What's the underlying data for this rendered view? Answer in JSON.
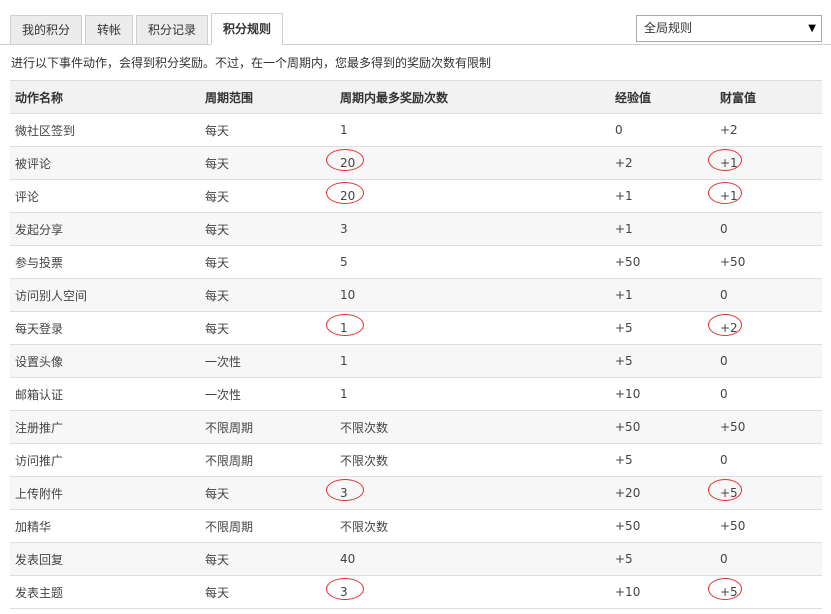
{
  "tabs": [
    {
      "label": "我的积分",
      "active": false
    },
    {
      "label": "转帐",
      "active": false
    },
    {
      "label": "积分记录",
      "active": false
    },
    {
      "label": "积分规则",
      "active": true
    }
  ],
  "rule_select": {
    "selected": "全局规则"
  },
  "intro": "进行以下事件动作，会得到积分奖励。不过，在一个周期内，您最多得到的奖励次数有限制",
  "columns": [
    "动作名称",
    "周期范围",
    "周期内最多奖励次数",
    "经验值",
    "财富值"
  ],
  "rows": [
    {
      "action": "微社区签到",
      "period": "每天",
      "max": "1",
      "exp": "0",
      "wealth": "+2",
      "circle_max": false,
      "circle_wealth": false
    },
    {
      "action": "被评论",
      "period": "每天",
      "max": "20",
      "exp": "+2",
      "wealth": "+1",
      "circle_max": true,
      "circle_wealth": true
    },
    {
      "action": "评论",
      "period": "每天",
      "max": "20",
      "exp": "+1",
      "wealth": "+1",
      "circle_max": true,
      "circle_wealth": true
    },
    {
      "action": "发起分享",
      "period": "每天",
      "max": "3",
      "exp": "+1",
      "wealth": "0",
      "circle_max": false,
      "circle_wealth": false
    },
    {
      "action": "参与投票",
      "period": "每天",
      "max": "5",
      "exp": "+50",
      "wealth": "+50",
      "circle_max": false,
      "circle_wealth": false
    },
    {
      "action": "访问别人空间",
      "period": "每天",
      "max": "10",
      "exp": "+1",
      "wealth": "0",
      "circle_max": false,
      "circle_wealth": false
    },
    {
      "action": "每天登录",
      "period": "每天",
      "max": "1",
      "exp": "+5",
      "wealth": "+2",
      "circle_max": true,
      "circle_wealth": true
    },
    {
      "action": "设置头像",
      "period": "一次性",
      "max": "1",
      "exp": "+5",
      "wealth": "0",
      "circle_max": false,
      "circle_wealth": false
    },
    {
      "action": "邮箱认证",
      "period": "一次性",
      "max": "1",
      "exp": "+10",
      "wealth": "0",
      "circle_max": false,
      "circle_wealth": false
    },
    {
      "action": "注册推广",
      "period": "不限周期",
      "max": "不限次数",
      "exp": "+50",
      "wealth": "+50",
      "circle_max": false,
      "circle_wealth": false
    },
    {
      "action": "访问推广",
      "period": "不限周期",
      "max": "不限次数",
      "exp": "+5",
      "wealth": "0",
      "circle_max": false,
      "circle_wealth": false
    },
    {
      "action": "上传附件",
      "period": "每天",
      "max": "3",
      "exp": "+20",
      "wealth": "+5",
      "circle_max": true,
      "circle_wealth": true
    },
    {
      "action": "加精华",
      "period": "不限周期",
      "max": "不限次数",
      "exp": "+50",
      "wealth": "+50",
      "circle_max": false,
      "circle_wealth": false
    },
    {
      "action": "发表回复",
      "period": "每天",
      "max": "40",
      "exp": "+5",
      "wealth": "0",
      "circle_max": false,
      "circle_wealth": false
    },
    {
      "action": "发表主题",
      "period": "每天",
      "max": "3",
      "exp": "+10",
      "wealth": "+5",
      "circle_max": true,
      "circle_wealth": true
    }
  ],
  "colors": {
    "annotation": "#e0302e",
    "border": "#dedede",
    "header_bg": "#f2f2f2"
  }
}
